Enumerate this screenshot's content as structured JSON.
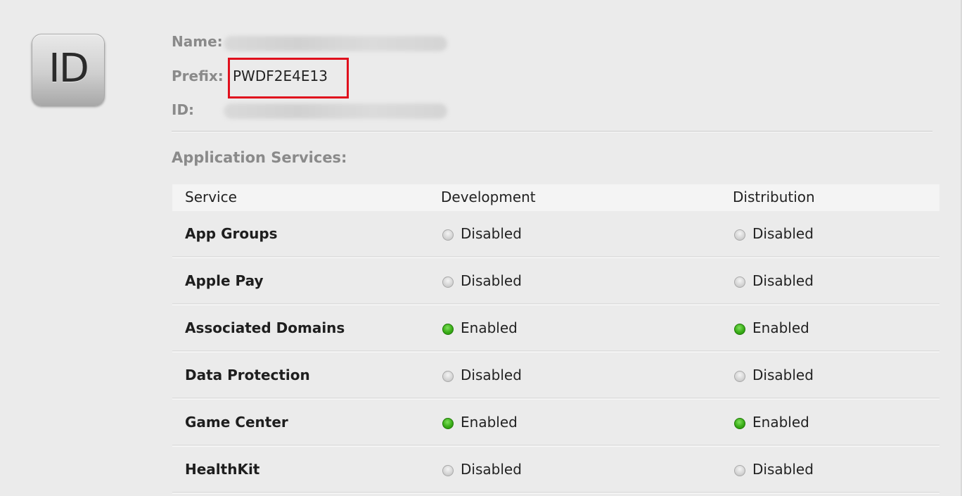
{
  "app_icon": {
    "text": "ID"
  },
  "meta": {
    "name_label": "Name:",
    "prefix_label": "Prefix:",
    "prefix_value": "PWDF2E4E13",
    "id_label": "ID:"
  },
  "section_title": "Application Services:",
  "table": {
    "headers": {
      "service": "Service",
      "development": "Development",
      "distribution": "Distribution"
    },
    "rows": [
      {
        "service": "App Groups",
        "development": "Disabled",
        "distribution": "Disabled",
        "dev_on": false,
        "dist_on": false
      },
      {
        "service": "Apple Pay",
        "development": "Disabled",
        "distribution": "Disabled",
        "dev_on": false,
        "dist_on": false
      },
      {
        "service": "Associated Domains",
        "development": "Enabled",
        "distribution": "Enabled",
        "dev_on": true,
        "dist_on": true
      },
      {
        "service": "Data Protection",
        "development": "Disabled",
        "distribution": "Disabled",
        "dev_on": false,
        "dist_on": false
      },
      {
        "service": "Game Center",
        "development": "Enabled",
        "distribution": "Enabled",
        "dev_on": true,
        "dist_on": true
      },
      {
        "service": "HealthKit",
        "development": "Disabled",
        "distribution": "Disabled",
        "dev_on": false,
        "dist_on": false
      }
    ]
  },
  "colors": {
    "highlight_box": "#e0101d",
    "enabled": "#3aad18",
    "disabled": "#d4d4d4"
  }
}
